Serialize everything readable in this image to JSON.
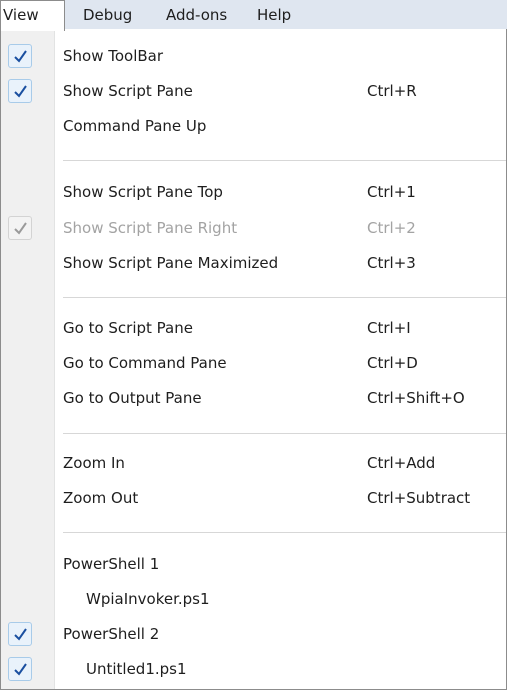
{
  "menubar": {
    "items": [
      {
        "label": "View"
      },
      {
        "label": "Debug"
      },
      {
        "label": "Add-ons"
      },
      {
        "label": "Help"
      }
    ]
  },
  "menu": {
    "items": [
      {
        "label": "Show ToolBar",
        "shortcut": "",
        "checked": true
      },
      {
        "label": "Show Script Pane",
        "shortcut": "Ctrl+R",
        "checked": true
      },
      {
        "label": "Command Pane Up",
        "shortcut": "",
        "checked": false
      },
      {
        "label": "Show Script Pane Top",
        "shortcut": "Ctrl+1",
        "checked": false
      },
      {
        "label": "Show Script Pane Right",
        "shortcut": "Ctrl+2",
        "checked": true,
        "disabled": true
      },
      {
        "label": "Show Script Pane Maximized",
        "shortcut": "Ctrl+3",
        "checked": false
      },
      {
        "label": "Go to Script Pane",
        "shortcut": "Ctrl+I",
        "checked": false
      },
      {
        "label": "Go to Command Pane",
        "shortcut": "Ctrl+D",
        "checked": false
      },
      {
        "label": "Go to Output Pane",
        "shortcut": "Ctrl+Shift+O",
        "checked": false
      },
      {
        "label": "Zoom In",
        "shortcut": "Ctrl+Add",
        "checked": false
      },
      {
        "label": "Zoom Out",
        "shortcut": "Ctrl+Subtract",
        "checked": false
      },
      {
        "label": "PowerShell 1",
        "shortcut": "",
        "checked": false
      },
      {
        "label": "WpiaInvoker.ps1",
        "shortcut": "",
        "checked": false
      },
      {
        "label": "PowerShell 2",
        "shortcut": "",
        "checked": true
      },
      {
        "label": "Untitled1.ps1",
        "shortcut": "",
        "checked": true
      }
    ]
  },
  "icons": {
    "check": "checkmark-icon"
  },
  "colors": {
    "check_mark": "#1a4fa0",
    "check_mark_disabled": "#9a9a9a",
    "menubar_bg": "#dfe6f0",
    "gutter_bg": "#f0f0f0",
    "disabled_text": "#a3a3a3"
  }
}
